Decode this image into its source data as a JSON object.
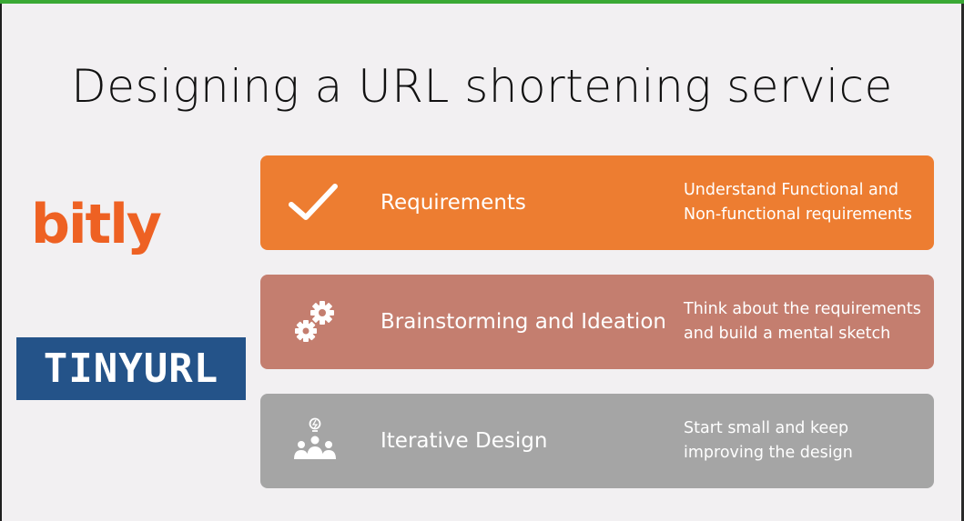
{
  "slide": {
    "title": "Designing a URL shortening service",
    "logos": {
      "bitly": "bitly",
      "tinyurl": "TINYURL"
    },
    "cards": [
      {
        "icon": "checkmark-icon",
        "label": "Requirements",
        "description": "Understand Functional and Non-functional requirements",
        "color": "#ed7d31"
      },
      {
        "icon": "gears-icon",
        "label": "Brainstorming and Ideation",
        "description": "Think about the requirements and build a mental sketch",
        "color": "#c47e6f"
      },
      {
        "icon": "team-idea-icon",
        "label": "Iterative Design",
        "description": "Start small and keep improving the design",
        "color": "#a5a5a5"
      }
    ]
  },
  "colors": {
    "accent_bar": "#3aa935",
    "bitly": "#ee6123",
    "tinyurl_bg": "#245389"
  }
}
